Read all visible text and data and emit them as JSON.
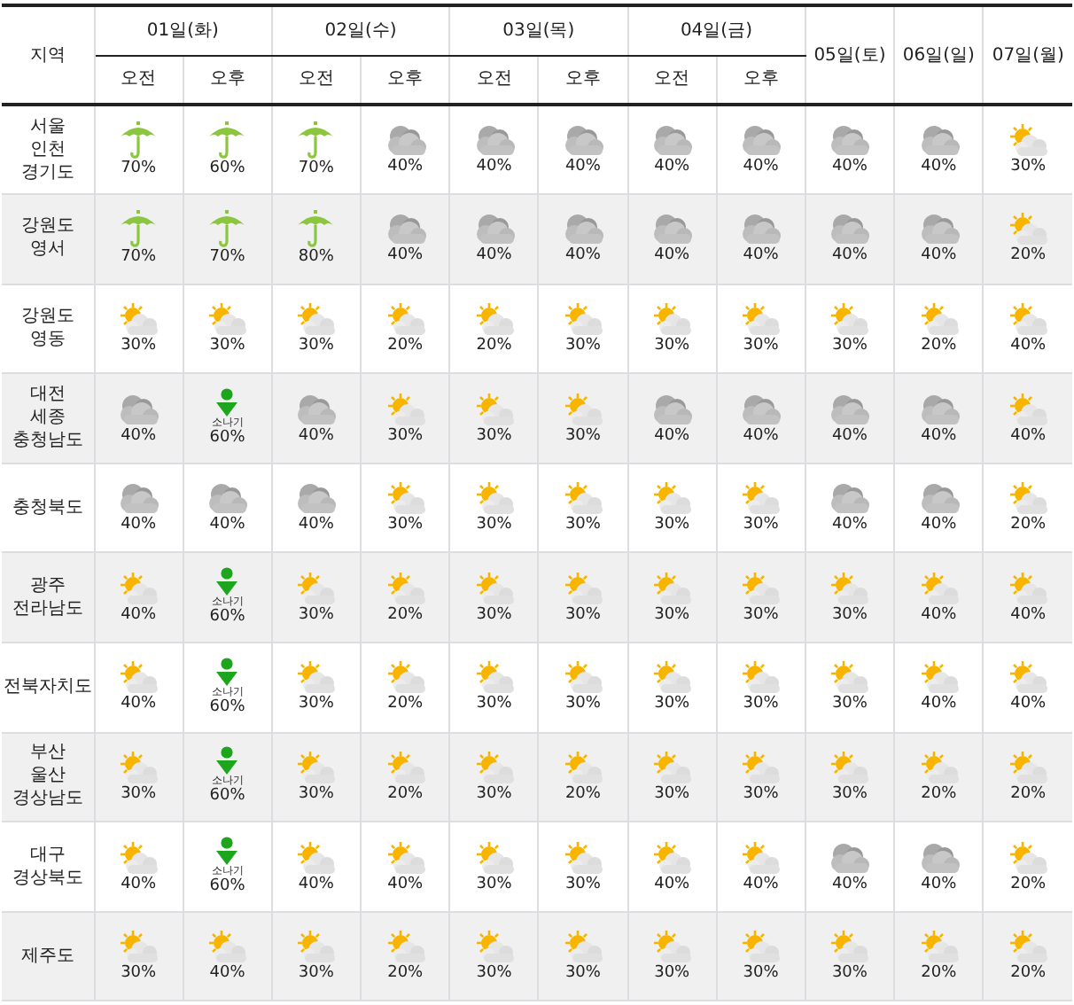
{
  "table": {
    "region_header": "지역",
    "days": [
      {
        "label": "01일(화)",
        "periods": [
          "오전",
          "오후"
        ]
      },
      {
        "label": "02일(수)",
        "periods": [
          "오전",
          "오후"
        ]
      },
      {
        "label": "03일(목)",
        "periods": [
          "오전",
          "오후"
        ]
      },
      {
        "label": "04일(금)",
        "periods": [
          "오전",
          "오후"
        ]
      },
      {
        "label": "05일(토)"
      },
      {
        "label": "06일(일)"
      },
      {
        "label": "07일(월)"
      }
    ],
    "rows": [
      {
        "region": [
          "서울",
          "인천",
          "경기도"
        ],
        "cells": [
          {
            "kind": "rain",
            "pop": "70%"
          },
          {
            "kind": "rain",
            "pop": "60%"
          },
          {
            "kind": "rain",
            "pop": "70%"
          },
          {
            "kind": "cloudy",
            "pop": "40%"
          },
          {
            "kind": "cloudy",
            "pop": "40%"
          },
          {
            "kind": "cloudy",
            "pop": "40%"
          },
          {
            "kind": "cloudy",
            "pop": "40%"
          },
          {
            "kind": "cloudy",
            "pop": "40%"
          },
          {
            "kind": "cloudy",
            "pop": "40%"
          },
          {
            "kind": "cloudy",
            "pop": "40%"
          },
          {
            "kind": "partly",
            "pop": "30%"
          }
        ]
      },
      {
        "region": [
          "강원도",
          "영서"
        ],
        "cells": [
          {
            "kind": "rain",
            "pop": "70%"
          },
          {
            "kind": "rain",
            "pop": "70%"
          },
          {
            "kind": "rain",
            "pop": "80%"
          },
          {
            "kind": "cloudy",
            "pop": "40%"
          },
          {
            "kind": "cloudy",
            "pop": "40%"
          },
          {
            "kind": "cloudy",
            "pop": "40%"
          },
          {
            "kind": "cloudy",
            "pop": "40%"
          },
          {
            "kind": "cloudy",
            "pop": "40%"
          },
          {
            "kind": "cloudy",
            "pop": "40%"
          },
          {
            "kind": "cloudy",
            "pop": "40%"
          },
          {
            "kind": "partly",
            "pop": "20%"
          }
        ]
      },
      {
        "region": [
          "강원도",
          "영동"
        ],
        "cells": [
          {
            "kind": "partly",
            "pop": "30%"
          },
          {
            "kind": "partly",
            "pop": "30%"
          },
          {
            "kind": "partly",
            "pop": "30%"
          },
          {
            "kind": "partly",
            "pop": "20%"
          },
          {
            "kind": "partly",
            "pop": "20%"
          },
          {
            "kind": "partly",
            "pop": "30%"
          },
          {
            "kind": "partly",
            "pop": "30%"
          },
          {
            "kind": "partly",
            "pop": "30%"
          },
          {
            "kind": "partly",
            "pop": "30%"
          },
          {
            "kind": "partly",
            "pop": "20%"
          },
          {
            "kind": "partly",
            "pop": "40%"
          }
        ]
      },
      {
        "region": [
          "대전",
          "세종",
          "충청남도"
        ],
        "cells": [
          {
            "kind": "cloudy",
            "pop": "40%"
          },
          {
            "kind": "shower",
            "label": "소나기",
            "pop": "60%"
          },
          {
            "kind": "cloudy",
            "pop": "40%"
          },
          {
            "kind": "partly",
            "pop": "30%"
          },
          {
            "kind": "partly",
            "pop": "30%"
          },
          {
            "kind": "partly",
            "pop": "30%"
          },
          {
            "kind": "cloudy",
            "pop": "40%"
          },
          {
            "kind": "cloudy",
            "pop": "40%"
          },
          {
            "kind": "cloudy",
            "pop": "40%"
          },
          {
            "kind": "cloudy",
            "pop": "40%"
          },
          {
            "kind": "partly",
            "pop": "40%"
          }
        ]
      },
      {
        "region": [
          "충청북도"
        ],
        "cells": [
          {
            "kind": "cloudy",
            "pop": "40%"
          },
          {
            "kind": "cloudy",
            "pop": "40%"
          },
          {
            "kind": "cloudy",
            "pop": "40%"
          },
          {
            "kind": "partly",
            "pop": "30%"
          },
          {
            "kind": "partly",
            "pop": "30%"
          },
          {
            "kind": "partly",
            "pop": "30%"
          },
          {
            "kind": "partly",
            "pop": "30%"
          },
          {
            "kind": "partly",
            "pop": "30%"
          },
          {
            "kind": "cloudy",
            "pop": "40%"
          },
          {
            "kind": "cloudy",
            "pop": "40%"
          },
          {
            "kind": "partly",
            "pop": "20%"
          }
        ]
      },
      {
        "region": [
          "광주",
          "전라남도"
        ],
        "cells": [
          {
            "kind": "partly",
            "pop": "40%"
          },
          {
            "kind": "shower",
            "label": "소나기",
            "pop": "60%"
          },
          {
            "kind": "partly",
            "pop": "30%"
          },
          {
            "kind": "partly",
            "pop": "20%"
          },
          {
            "kind": "partly",
            "pop": "30%"
          },
          {
            "kind": "partly",
            "pop": "30%"
          },
          {
            "kind": "partly",
            "pop": "30%"
          },
          {
            "kind": "partly",
            "pop": "30%"
          },
          {
            "kind": "partly",
            "pop": "30%"
          },
          {
            "kind": "partly",
            "pop": "40%"
          },
          {
            "kind": "partly",
            "pop": "40%"
          }
        ]
      },
      {
        "region": [
          "전북자치도"
        ],
        "cells": [
          {
            "kind": "partly",
            "pop": "40%"
          },
          {
            "kind": "shower",
            "label": "소나기",
            "pop": "60%"
          },
          {
            "kind": "partly",
            "pop": "30%"
          },
          {
            "kind": "partly",
            "pop": "20%"
          },
          {
            "kind": "partly",
            "pop": "30%"
          },
          {
            "kind": "partly",
            "pop": "30%"
          },
          {
            "kind": "partly",
            "pop": "30%"
          },
          {
            "kind": "partly",
            "pop": "30%"
          },
          {
            "kind": "partly",
            "pop": "30%"
          },
          {
            "kind": "partly",
            "pop": "40%"
          },
          {
            "kind": "partly",
            "pop": "40%"
          }
        ]
      },
      {
        "region": [
          "부산",
          "울산",
          "경상남도"
        ],
        "cells": [
          {
            "kind": "partly",
            "pop": "30%"
          },
          {
            "kind": "shower",
            "label": "소나기",
            "pop": "60%"
          },
          {
            "kind": "partly",
            "pop": "30%"
          },
          {
            "kind": "partly",
            "pop": "20%"
          },
          {
            "kind": "partly",
            "pop": "30%"
          },
          {
            "kind": "partly",
            "pop": "20%"
          },
          {
            "kind": "partly",
            "pop": "30%"
          },
          {
            "kind": "partly",
            "pop": "30%"
          },
          {
            "kind": "partly",
            "pop": "30%"
          },
          {
            "kind": "partly",
            "pop": "20%"
          },
          {
            "kind": "partly",
            "pop": "20%"
          }
        ]
      },
      {
        "region": [
          "대구",
          "경상북도"
        ],
        "cells": [
          {
            "kind": "partly",
            "pop": "40%"
          },
          {
            "kind": "shower",
            "label": "소나기",
            "pop": "60%"
          },
          {
            "kind": "partly",
            "pop": "40%"
          },
          {
            "kind": "partly",
            "pop": "40%"
          },
          {
            "kind": "partly",
            "pop": "30%"
          },
          {
            "kind": "partly",
            "pop": "30%"
          },
          {
            "kind": "partly",
            "pop": "40%"
          },
          {
            "kind": "partly",
            "pop": "40%"
          },
          {
            "kind": "cloudy",
            "pop": "40%"
          },
          {
            "kind": "cloudy",
            "pop": "40%"
          },
          {
            "kind": "partly",
            "pop": "20%"
          }
        ]
      },
      {
        "region": [
          "제주도"
        ],
        "cells": [
          {
            "kind": "partly",
            "pop": "30%"
          },
          {
            "kind": "partly",
            "pop": "40%"
          },
          {
            "kind": "partly",
            "pop": "30%"
          },
          {
            "kind": "partly",
            "pop": "20%"
          },
          {
            "kind": "partly",
            "pop": "30%"
          },
          {
            "kind": "partly",
            "pop": "30%"
          },
          {
            "kind": "partly",
            "pop": "30%"
          },
          {
            "kind": "partly",
            "pop": "30%"
          },
          {
            "kind": "partly",
            "pop": "30%"
          },
          {
            "kind": "partly",
            "pop": "20%"
          },
          {
            "kind": "partly",
            "pop": "20%"
          }
        ]
      }
    ]
  }
}
